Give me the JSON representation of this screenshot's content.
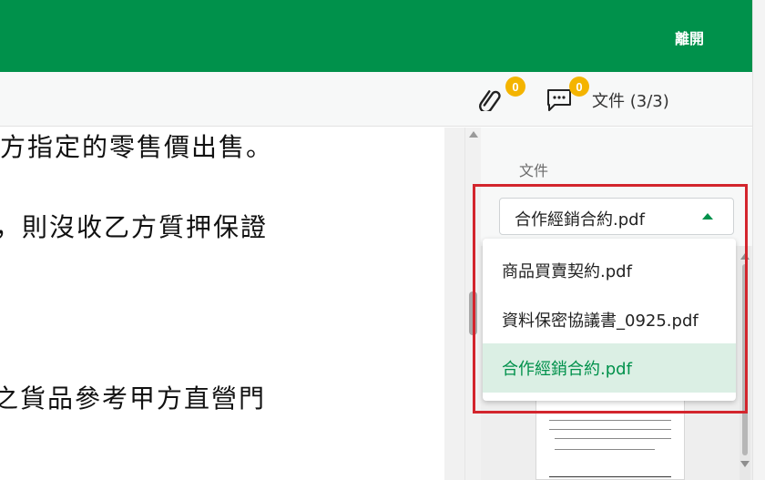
{
  "header": {
    "leave_label": "離開"
  },
  "toolbar": {
    "attachments_count": "0",
    "comments_count": "0",
    "document_counter": "文件 (3/3)"
  },
  "document": {
    "lines": [
      "方指定的零售價出售。",
      "，則沒收乙方質押保證",
      "之貨品參考甲方直營門"
    ]
  },
  "side_panel": {
    "label": "文件",
    "select": {
      "value": "合作經銷合約.pdf"
    },
    "options": [
      {
        "label": "商品買賣契約.pdf",
        "selected": false
      },
      {
        "label": "資料保密協議書_0925.pdf",
        "selected": false
      },
      {
        "label": "合作經銷合約.pdf",
        "selected": true
      }
    ]
  },
  "colors": {
    "brand_green": "#00914b",
    "badge_yellow": "#f4b400",
    "highlight_red": "#d3252d",
    "selected_option_bg": "#dbefe4"
  },
  "icons": {
    "attachment": "paperclip-icon",
    "comment": "comment-icon",
    "panel_toggle": "side-panel-icon",
    "dropdown_caret": "caret-up-icon"
  }
}
